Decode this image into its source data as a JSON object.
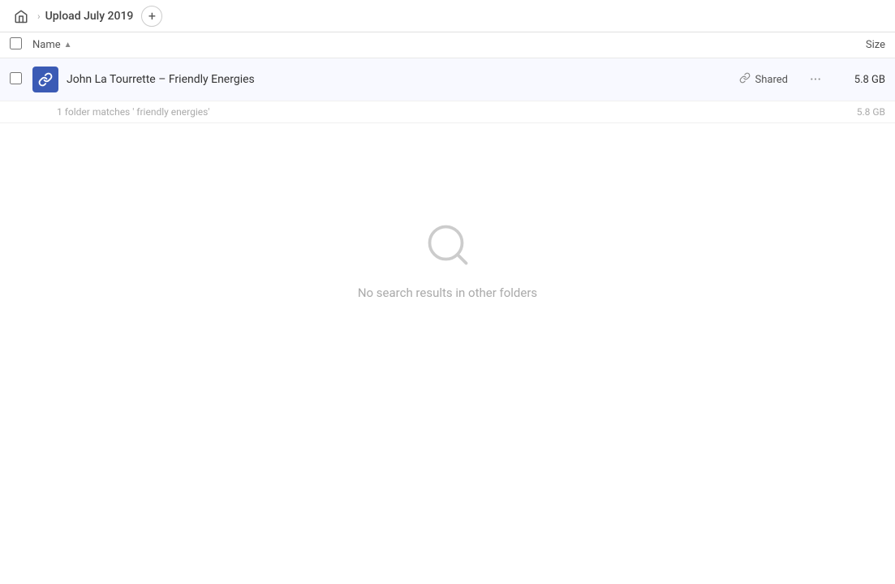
{
  "header": {
    "home_label": "Home",
    "breadcrumb_title": "Upload July 2019",
    "add_button_label": "+"
  },
  "columns": {
    "name_label": "Name",
    "size_label": "Size",
    "sort_indicator": "▲"
  },
  "file_row": {
    "name": "John La Tourrette – Friendly Energies",
    "shared_label": "Shared",
    "size": "5.8 GB",
    "more_options": "···"
  },
  "match_row": {
    "text": "1 folder matches ' friendly energies'",
    "size": "5.8 GB"
  },
  "empty_state": {
    "label": "No search results in other folders"
  }
}
